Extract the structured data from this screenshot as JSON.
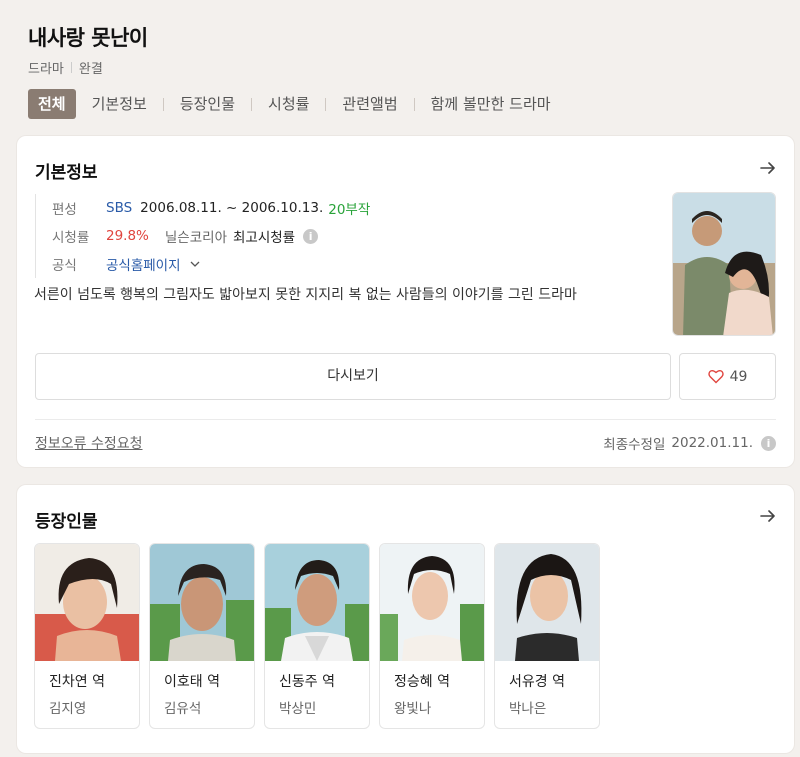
{
  "header": {
    "title": "내사랑 못난이",
    "genre": "드라마",
    "status": "완결",
    "tabs": [
      {
        "label": "전체"
      },
      {
        "label": "기본정보"
      },
      {
        "label": "등장인물"
      },
      {
        "label": "시청률"
      },
      {
        "label": "관련앨범"
      },
      {
        "label": "함께 볼만한 드라마"
      }
    ]
  },
  "basic_info": {
    "title": "기본정보",
    "broadcast_label": "편성",
    "channel": "SBS",
    "period": "2006.08.11. ~ 2006.10.13.",
    "episodes": "20부작",
    "rating_label": "시청률",
    "rating": "29.8%",
    "rating_source": "닐슨코리아",
    "rating_type": "최고시청률",
    "official_label": "공식",
    "official_link": "공식홈페이지",
    "description": "서른이 넘도록 행복의 그림자도 밟아보지 못한 지지리 복 없는 사람들의 이야기를 그린 드라마",
    "rewatch_label": "다시보기",
    "like_count": "49",
    "report_link": "정보오류 수정요청",
    "updated_label": "최종수정일",
    "updated_date": "2022.01.11."
  },
  "cast": {
    "title": "등장인물",
    "members": [
      {
        "role": "진차연 역",
        "actor": "김지영"
      },
      {
        "role": "이호태 역",
        "actor": "김유석"
      },
      {
        "role": "신동주 역",
        "actor": "박상민"
      },
      {
        "role": "정승혜 역",
        "actor": "왕빛나"
      },
      {
        "role": "서유경 역",
        "actor": "박나은"
      }
    ]
  },
  "colors": {
    "active_tab": "#8a7c72",
    "link_blue": "#2a5ba8",
    "episodes_green": "#29a33a",
    "rating_red": "#e0443e",
    "page_bg": "#f3f0ed"
  },
  "icons": [
    "arrow-right-icon",
    "info-icon",
    "chevron-down-icon",
    "heart-icon"
  ]
}
